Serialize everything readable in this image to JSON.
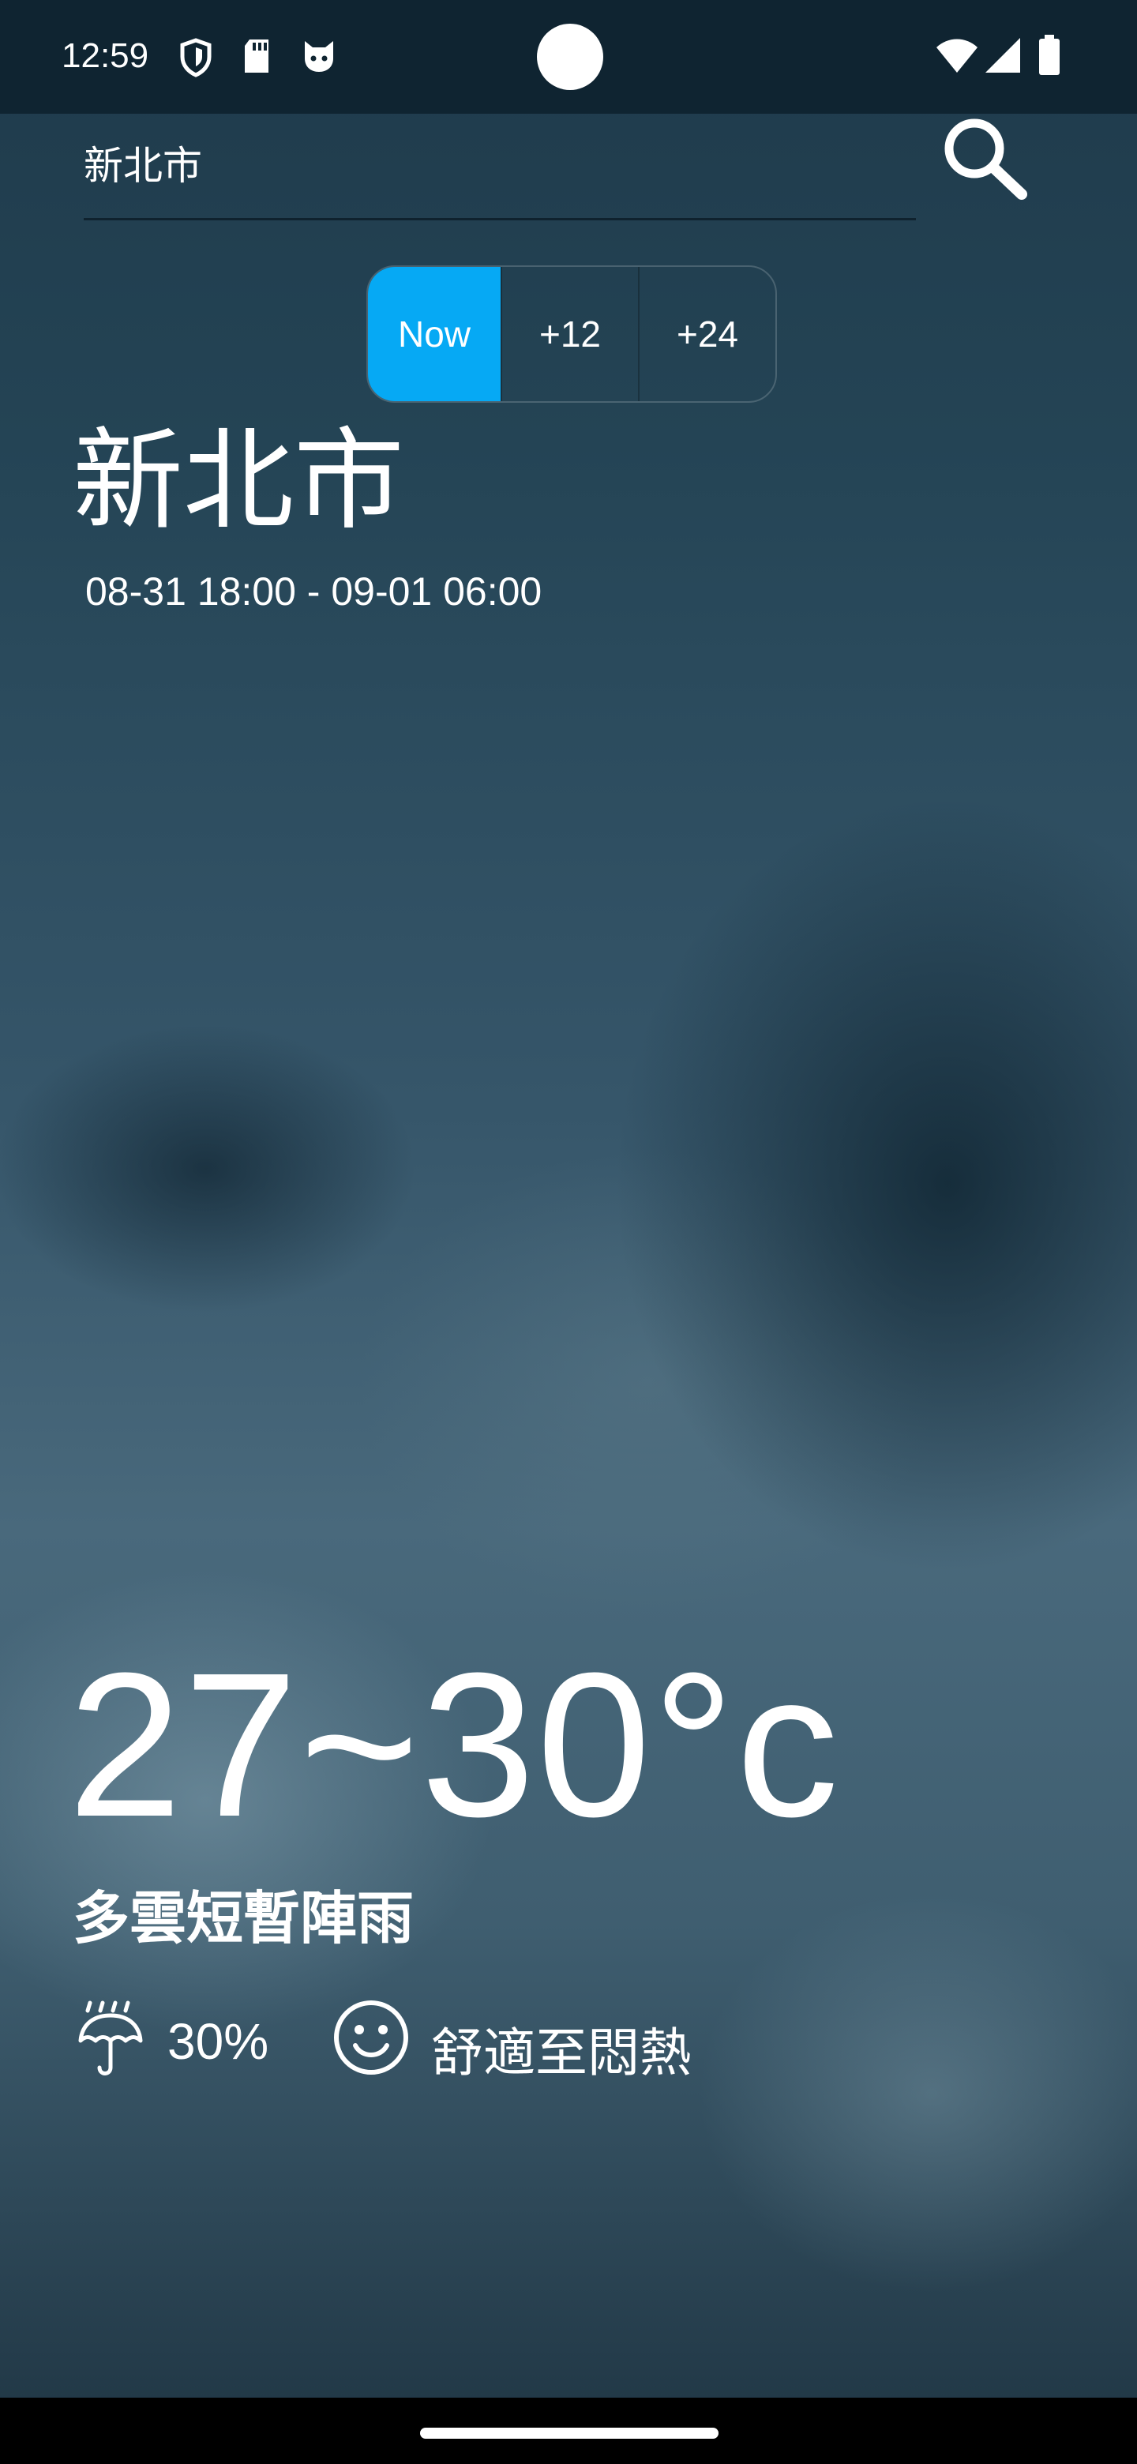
{
  "status_bar": {
    "time": "12:59",
    "icons": [
      "shield-icon",
      "sd-card-icon",
      "cat-icon",
      "wifi-icon",
      "signal-icon",
      "battery-icon"
    ]
  },
  "search": {
    "value": "新北市",
    "icon": "search-icon"
  },
  "time_selector": {
    "options": [
      "Now",
      "+12",
      "+24"
    ],
    "selected": "Now",
    "accent_color": "#06a9f4"
  },
  "location": {
    "city": "新北市",
    "period": "08-31 18:00 - 09-01 06:00"
  },
  "weather": {
    "temperature": "27~30°c",
    "description": "多雲短暫陣雨",
    "rain_icon": "umbrella-rain-icon",
    "rain_chance": "30%",
    "comfort_icon": "smile-icon",
    "comfort": "舒適至悶熱"
  }
}
